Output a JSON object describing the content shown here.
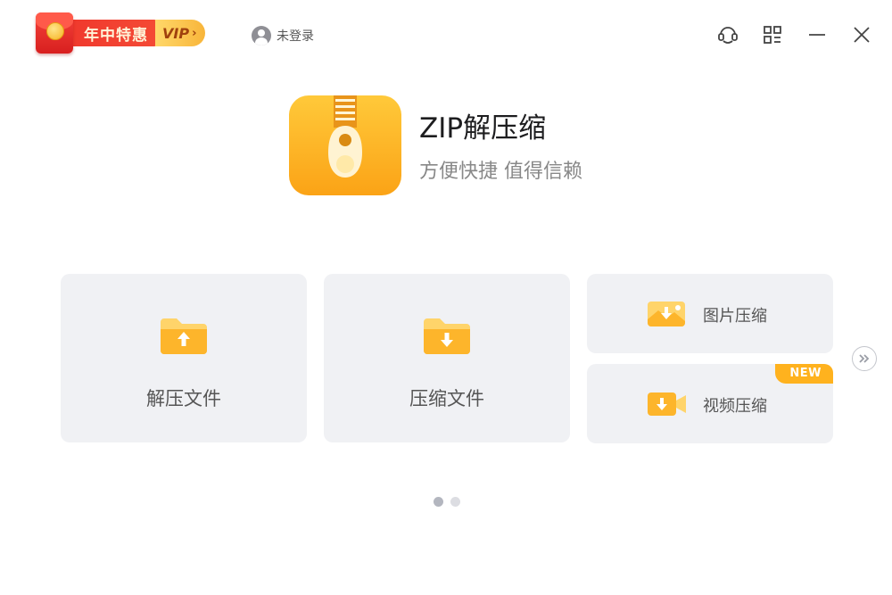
{
  "header": {
    "promo": {
      "label": "年中特惠",
      "vip_label": "VIP",
      "chevron": "›"
    },
    "user": {
      "label": "未登录",
      "icon": "user-avatar-icon"
    },
    "controls": [
      {
        "name": "customer-service",
        "icon": "headset-icon"
      },
      {
        "name": "menu",
        "icon": "grid-menu-icon"
      },
      {
        "name": "minimize",
        "icon": "minimize-icon"
      },
      {
        "name": "close",
        "icon": "close-icon"
      }
    ]
  },
  "hero": {
    "title": "ZIP解压缩",
    "subtitle": "方便快捷 值得信赖",
    "icon": "zipper-icon"
  },
  "cards": {
    "extract": {
      "label": "解压文件",
      "icon": "folder-upload-icon"
    },
    "compress": {
      "label": "压缩文件",
      "icon": "folder-download-icon"
    },
    "image": {
      "label": "图片压缩",
      "icon": "image-compress-icon"
    },
    "video": {
      "label": "视频压缩",
      "icon": "video-compress-icon",
      "badge": "NEW"
    }
  },
  "pagination": {
    "total": 2,
    "current": 1
  },
  "colors": {
    "accent": "#fba316",
    "card_bg": "#f0f1f4",
    "promo_red": "#f0392d",
    "vip_gold": "#f8b53a"
  }
}
